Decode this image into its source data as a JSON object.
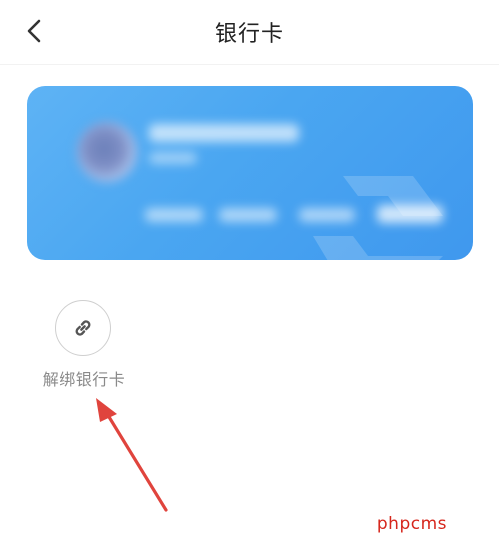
{
  "header": {
    "title": "银行卡"
  },
  "icons": {
    "back": "chevron-left-icon",
    "unbind": "link-icon"
  },
  "actions": {
    "unbind_label": "解绑银行卡"
  },
  "watermark": {
    "text": "phpcms"
  },
  "colors": {
    "card_gradient_start": "#5eb3f5",
    "card_gradient_end": "#3f98ee",
    "arrow": "#e0443d",
    "watermark": "#d6261c"
  }
}
